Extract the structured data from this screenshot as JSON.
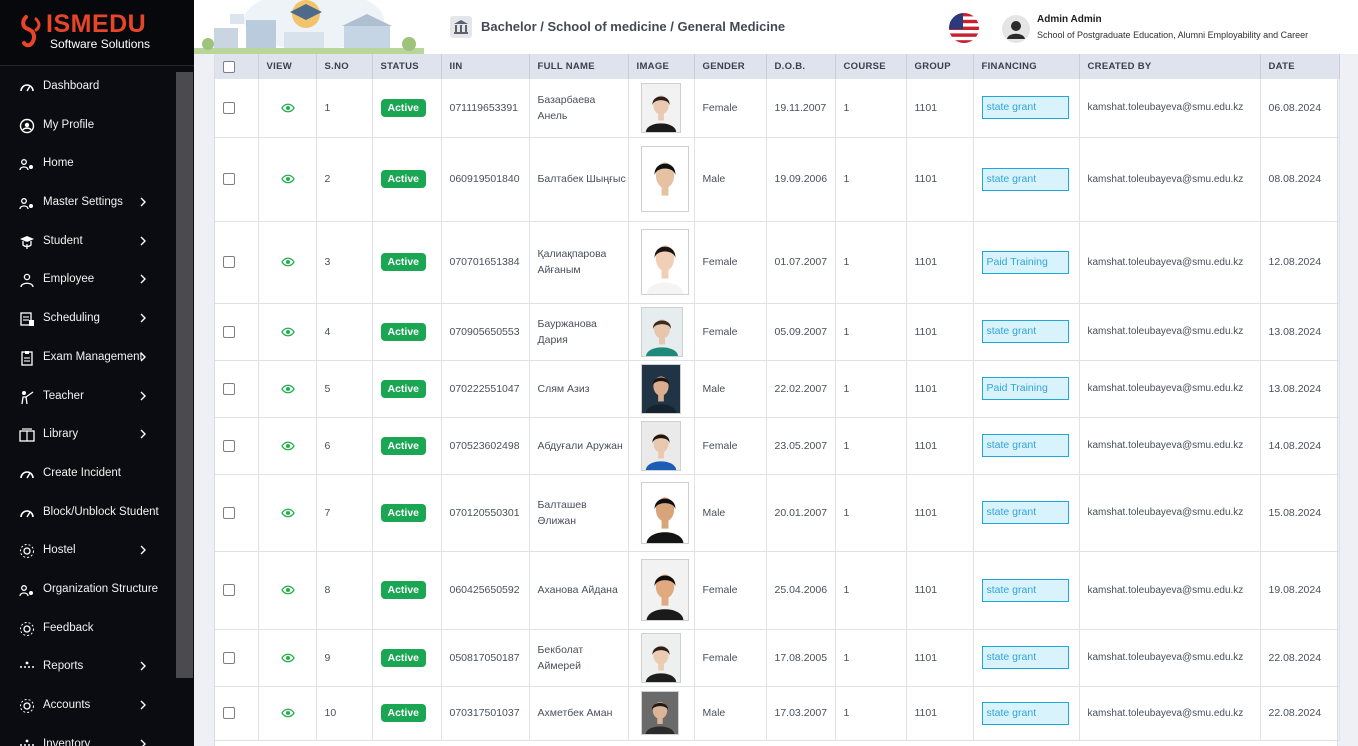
{
  "app": {
    "brand": "ISMEDU",
    "tagline": "Software Solutions"
  },
  "sidebar": {
    "items": [
      {
        "label": "Dashboard",
        "icon": "dashboard-icon",
        "chevron": false
      },
      {
        "label": "My Profile",
        "icon": "profile-icon",
        "chevron": false
      },
      {
        "label": "Home",
        "icon": "home-icon",
        "chevron": false
      },
      {
        "label": "Master Settings",
        "icon": "settings-icon",
        "chevron": true
      },
      {
        "label": "Student",
        "icon": "student-icon",
        "chevron": true
      },
      {
        "label": "Employee",
        "icon": "employee-icon",
        "chevron": true
      },
      {
        "label": "Scheduling",
        "icon": "scheduling-icon",
        "chevron": true
      },
      {
        "label": "Exam Management",
        "icon": "exam-icon",
        "chevron": true
      },
      {
        "label": "Teacher",
        "icon": "teacher-icon",
        "chevron": true
      },
      {
        "label": "Library",
        "icon": "library-icon",
        "chevron": true
      },
      {
        "label": "Create Incident",
        "icon": "incident-icon",
        "chevron": false
      },
      {
        "label": "Block/Unblock Student",
        "icon": "block-icon",
        "chevron": false
      },
      {
        "label": "Hostel",
        "icon": "hostel-icon",
        "chevron": true
      },
      {
        "label": "Organization Structure",
        "icon": "org-icon",
        "chevron": false
      },
      {
        "label": "Feedback",
        "icon": "feedback-icon",
        "chevron": false
      },
      {
        "label": "Reports",
        "icon": "reports-icon",
        "chevron": true
      },
      {
        "label": "Accounts",
        "icon": "accounts-icon",
        "chevron": true
      },
      {
        "label": "Inventory",
        "icon": "inventory-icon",
        "chevron": true
      }
    ]
  },
  "header": {
    "breadcrumb": "Bachelor / School of medicine / General Medicine",
    "user_name": "Admin Admin",
    "user_org": "School of Postgraduate Education, Alumni Employability and Career"
  },
  "table": {
    "columns": [
      "",
      "VIEW",
      "S.NO",
      "STATUS",
      "IIN",
      "FULL NAME",
      "IMAGE",
      "GENDER",
      "D.O.B.",
      "COURSE",
      "GROUP",
      "FINANCING",
      "CREATED BY",
      "DATE"
    ],
    "rows": [
      {
        "sno": "1",
        "status": "Active",
        "iin": "071119653391",
        "name": "Базарбаева Анель",
        "gender": "Female",
        "dob": "19.11.2007",
        "course": "1",
        "group": "1101",
        "financing": "state grant",
        "created_by": "kamshat.toleubayeva@smu.edu.kz",
        "date": "06.08.2024"
      },
      {
        "sno": "2",
        "status": "Active",
        "iin": "060919501840",
        "name": "Балтабек Шыңғыс",
        "gender": "Male",
        "dob": "19.09.2006",
        "course": "1",
        "group": "1101",
        "financing": "state grant",
        "created_by": "kamshat.toleubayeva@smu.edu.kz",
        "date": "08.08.2024"
      },
      {
        "sno": "3",
        "status": "Active",
        "iin": "070701651384",
        "name": "Қалиақпарова Айғаным",
        "gender": "Female",
        "dob": "01.07.2007",
        "course": "1",
        "group": "1101",
        "financing": "Paid Training",
        "created_by": "kamshat.toleubayeva@smu.edu.kz",
        "date": "12.08.2024"
      },
      {
        "sno": "4",
        "status": "Active",
        "iin": "070905650553",
        "name": "Бауржанова Дария",
        "gender": "Female",
        "dob": "05.09.2007",
        "course": "1",
        "group": "1101",
        "financing": "state grant",
        "created_by": "kamshat.toleubayeva@smu.edu.kz",
        "date": "13.08.2024"
      },
      {
        "sno": "5",
        "status": "Active",
        "iin": "070222551047",
        "name": "Слям Азиз",
        "gender": "Male",
        "dob": "22.02.2007",
        "course": "1",
        "group": "1101",
        "financing": "Paid Training",
        "created_by": "kamshat.toleubayeva@smu.edu.kz",
        "date": "13.08.2024"
      },
      {
        "sno": "6",
        "status": "Active",
        "iin": "070523602498",
        "name": "Абдуғали Аружан",
        "gender": "Female",
        "dob": "23.05.2007",
        "course": "1",
        "group": "1101",
        "financing": "state grant",
        "created_by": "kamshat.toleubayeva@smu.edu.kz",
        "date": "14.08.2024"
      },
      {
        "sno": "7",
        "status": "Active",
        "iin": "070120550301",
        "name": "Балташев Әлижан",
        "gender": "Male",
        "dob": "20.01.2007",
        "course": "1",
        "group": "1101",
        "financing": "state grant",
        "created_by": "kamshat.toleubayeva@smu.edu.kz",
        "date": "15.08.2024"
      },
      {
        "sno": "8",
        "status": "Active",
        "iin": "060425650592",
        "name": "Аханова Айдана",
        "gender": "Female",
        "dob": "25.04.2006",
        "course": "1",
        "group": "1101",
        "financing": "state grant",
        "created_by": "kamshat.toleubayeva@smu.edu.kz",
        "date": "19.08.2024"
      },
      {
        "sno": "9",
        "status": "Active",
        "iin": "050817050187",
        "name": "Бекболат Аймерей",
        "gender": "Female",
        "dob": "17.08.2005",
        "course": "1",
        "group": "1101",
        "financing": "state grant",
        "created_by": "kamshat.toleubayeva@smu.edu.kz",
        "date": "22.08.2024"
      },
      {
        "sno": "10",
        "status": "Active",
        "iin": "070317501037",
        "name": "Ахметбек Аман",
        "gender": "Male",
        "dob": "17.03.2007",
        "course": "1",
        "group": "1101",
        "financing": "state grant",
        "created_by": "kamshat.toleubayeva@smu.edu.kz",
        "date": "22.08.2024"
      }
    ]
  },
  "colors": {
    "active": "#1aa653",
    "financing_border": "#1ea6dd",
    "financing_bg": "#d8f3fb",
    "brand": "#e8442a"
  }
}
